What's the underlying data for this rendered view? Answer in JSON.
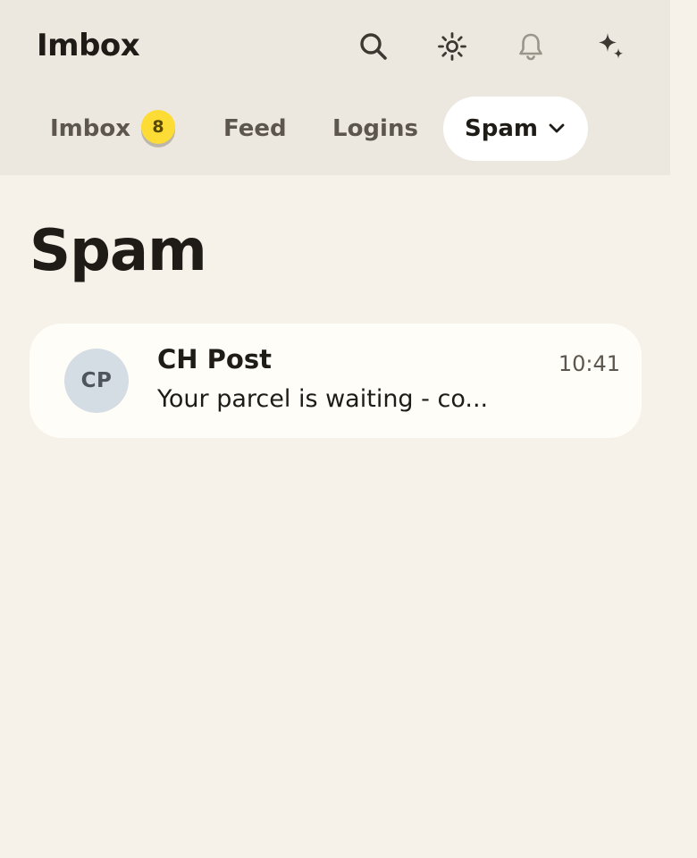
{
  "header": {
    "app_title": "Imbox",
    "icons": [
      "search-icon",
      "sun-icon",
      "bell-icon",
      "sparkles-icon"
    ]
  },
  "tabs": [
    {
      "label": "Imbox",
      "badge": "8"
    },
    {
      "label": "Feed"
    },
    {
      "label": "Logins"
    },
    {
      "label": "Spam",
      "active": true
    }
  ],
  "page": {
    "title": "Spam"
  },
  "messages": [
    {
      "avatar_initials": "CP",
      "sender": "CH Post",
      "time": "10:41",
      "snippet": "Your parcel is waiting - co..."
    }
  ],
  "colors": {
    "header_bg": "#ede8df",
    "page_bg": "#f6f2e9",
    "badge": "#fddc35",
    "card_bg": "#fffdf7",
    "avatar_bg": "#d4dce4"
  }
}
